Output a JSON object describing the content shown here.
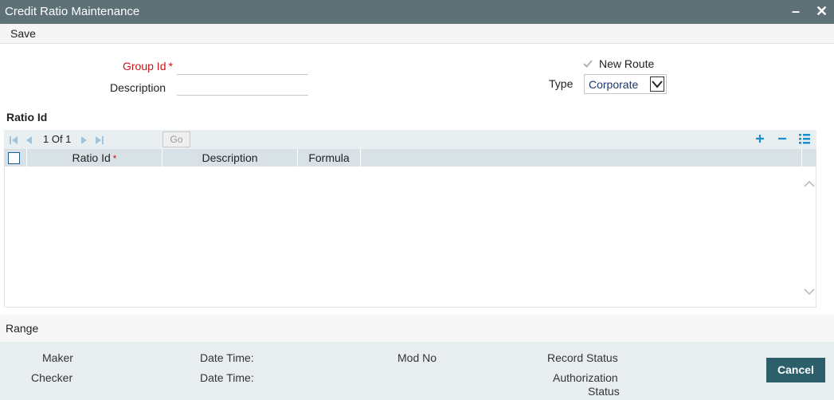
{
  "window": {
    "title": "Credit Ratio Maintenance",
    "minimize_label": "–",
    "close_label": "✕"
  },
  "menu": {
    "save_label": "Save"
  },
  "form": {
    "group_id": {
      "label": "Group Id",
      "required_mark": "*",
      "value": ""
    },
    "description": {
      "label": "Description",
      "value": ""
    },
    "new_route": {
      "label": "New Route",
      "checked": true
    },
    "type": {
      "label": "Type",
      "selected": "Corporate"
    }
  },
  "ratio_section": {
    "title": "Ratio Id",
    "pager": {
      "text": "1 Of 1",
      "go_label": "Go"
    },
    "columns": [
      {
        "label": "Ratio Id",
        "required_mark": "*"
      },
      {
        "label": "Description"
      },
      {
        "label": "Formula"
      }
    ],
    "rows": []
  },
  "range": {
    "label": "Range"
  },
  "audit": {
    "maker": "Maker",
    "checker": "Checker",
    "date_time_1": "Date Time:",
    "date_time_2": "Date Time:",
    "mod_no": "Mod No",
    "record_status": "Record Status",
    "authorization_status_line1": "Authorization",
    "authorization_status_line2": "Status"
  },
  "footer": {
    "cancel_label": "Cancel"
  },
  "colors": {
    "titlebar": "#5d7177",
    "required": "#c4161c",
    "accent_blue": "#1a8fc9",
    "cancel_button": "#2c5f6a"
  }
}
